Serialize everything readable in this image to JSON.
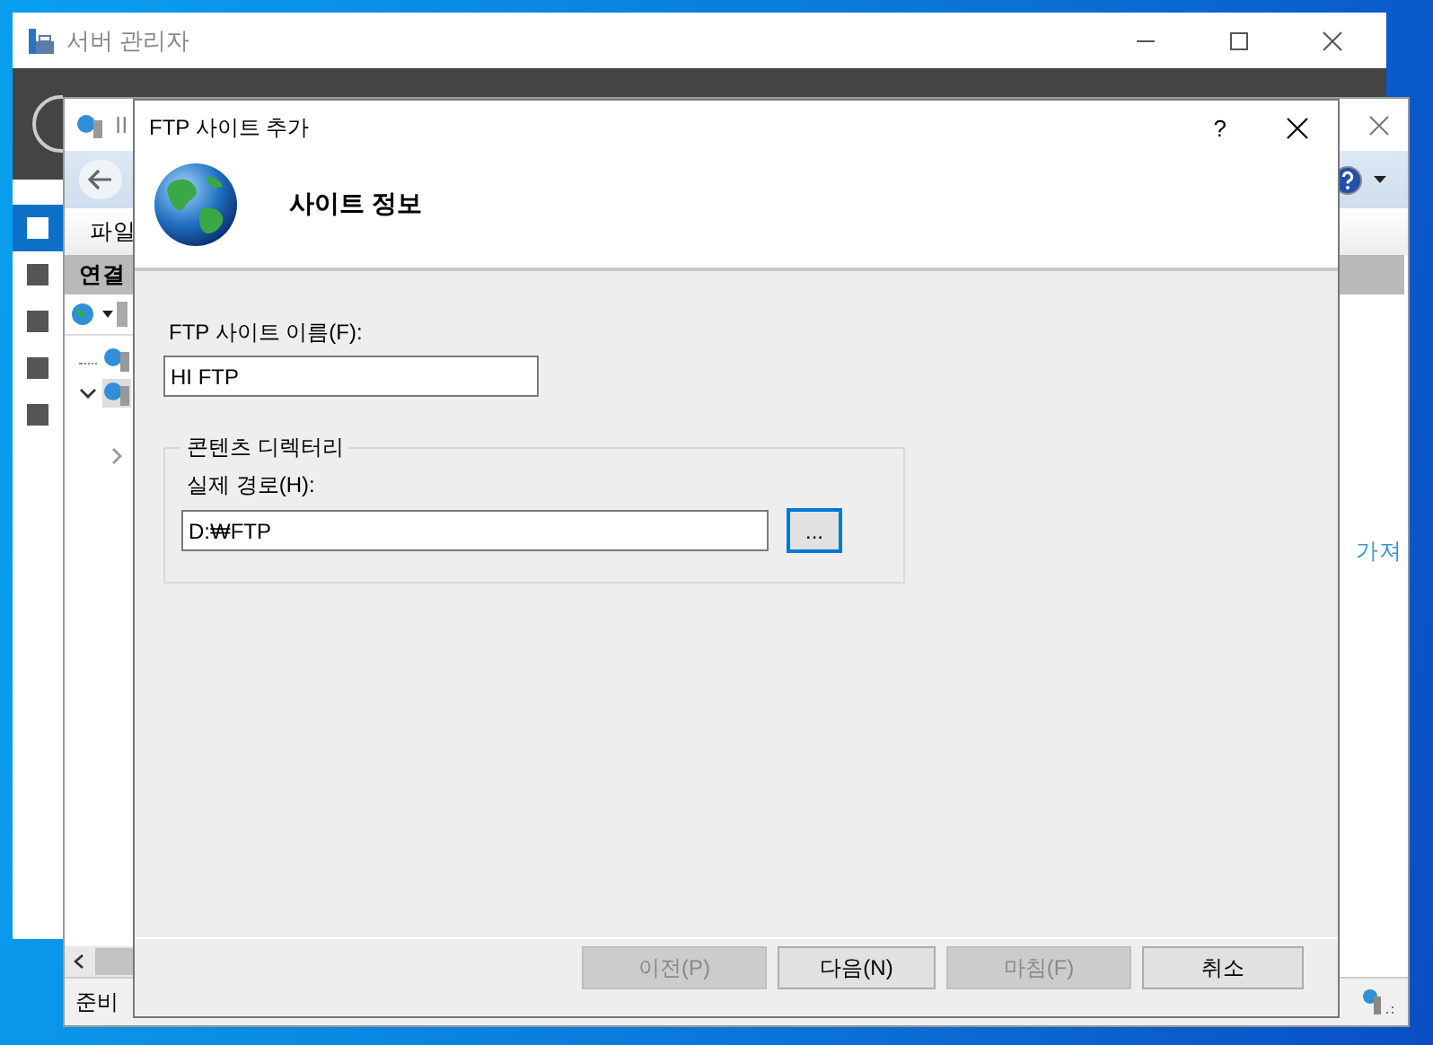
{
  "server_manager": {
    "title": "서버 관리자",
    "nav": [
      {
        "selected": true
      },
      {
        "selected": false
      },
      {
        "selected": false
      },
      {
        "selected": false
      },
      {
        "selected": false
      }
    ]
  },
  "iis_manager": {
    "title": "II",
    "menu": [
      "파일"
    ],
    "connections_title": "연결",
    "tree": [
      {
        "expanded": false
      },
      {
        "expanded": true,
        "children": [
          {
            "expanded": false
          }
        ]
      }
    ],
    "actions_link": "가져",
    "status_bar": "준비"
  },
  "dialog": {
    "title": "FTP 사이트 추가",
    "help": "?",
    "heading": "사이트 정보",
    "site_name": {
      "label": "FTP 사이트 이름(F):",
      "value": "HI FTP"
    },
    "content_directory": {
      "legend": "콘텐츠 디렉터리",
      "path_label": "실제 경로(H):",
      "path_value": "D:₩FTP",
      "browse": {
        "label": "...",
        "focused": true
      }
    },
    "buttons": [
      {
        "label": "이전(P)",
        "disabled": true
      },
      {
        "label": "다음(N)",
        "disabled": false
      },
      {
        "label": "마침(F)",
        "disabled": true
      },
      {
        "label": "취소",
        "disabled": false
      }
    ]
  }
}
